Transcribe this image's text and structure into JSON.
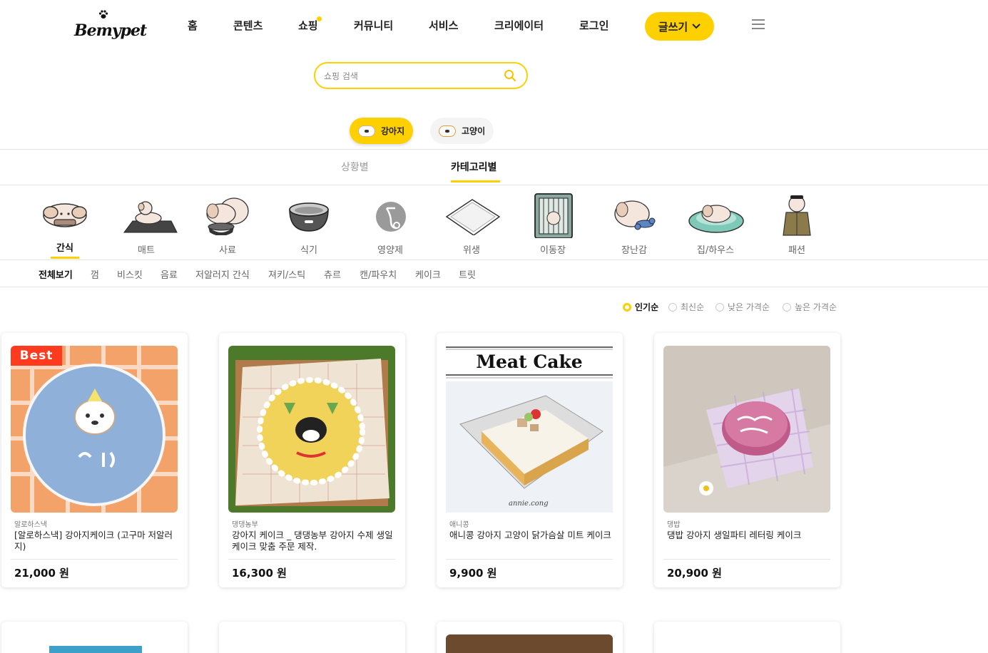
{
  "header": {
    "logo": "Bemypet",
    "nav": [
      {
        "label": "홈"
      },
      {
        "label": "콘텐츠"
      },
      {
        "label": "쇼핑"
      },
      {
        "label": "커뮤니티"
      },
      {
        "label": "서비스"
      },
      {
        "label": "크리에이터"
      },
      {
        "label": "로그인"
      }
    ],
    "write_button": "글쓰기",
    "accent": "#ffd000"
  },
  "search": {
    "placeholder": "쇼핑 검색",
    "value": ""
  },
  "pet_types": [
    {
      "label": "강아지",
      "active": true
    },
    {
      "label": "고양이",
      "active": false
    }
  ],
  "mode_tabs": [
    {
      "label": "상황별",
      "active": false
    },
    {
      "label": "카테고리별",
      "active": true
    }
  ],
  "categories": [
    {
      "label": "간식",
      "icon": "snack-dog-icon",
      "active": true
    },
    {
      "label": "매트",
      "icon": "mat-icon"
    },
    {
      "label": "사료",
      "icon": "food-bowl-dog-icon"
    },
    {
      "label": "식기",
      "icon": "bowl-icon"
    },
    {
      "label": "영양제",
      "icon": "supplement-icon"
    },
    {
      "label": "위생",
      "icon": "pee-pad-icon"
    },
    {
      "label": "이동장",
      "icon": "carrier-icon"
    },
    {
      "label": "장난감",
      "icon": "toy-icon"
    },
    {
      "label": "집/하우스",
      "icon": "house-cushion-icon"
    },
    {
      "label": "패션",
      "icon": "fashion-icon"
    }
  ],
  "subcategories": [
    {
      "label": "전체보기",
      "active": true
    },
    {
      "label": "껌"
    },
    {
      "label": "비스킷"
    },
    {
      "label": "음료"
    },
    {
      "label": "저알러지 간식"
    },
    {
      "label": "져키/스틱"
    },
    {
      "label": "츄르"
    },
    {
      "label": "캔/파우치"
    },
    {
      "label": "케이크"
    },
    {
      "label": "트릿"
    }
  ],
  "sort_options": [
    {
      "label": "인기순",
      "active": true
    },
    {
      "label": "최신순"
    },
    {
      "label": "낮은 가격순"
    },
    {
      "label": "높은 가격순"
    }
  ],
  "products": [
    {
      "seller": "알로하스낵",
      "title": "[알로하스낵] 강아지케이크 (고구마 저알러지)",
      "price": "21,000 원",
      "badge": "Best"
    },
    {
      "seller": "댕댕농부",
      "title": "강아지 케이크 _ 댕댕농부 강아지 수제 생일 케이크 맞춤 주문 제작.",
      "price": "16,300 원"
    },
    {
      "seller": "애니콩",
      "title": "애니콩 강아지 고양이 닭가슴살 미트 케이크",
      "price": "9,900 원",
      "image_caption": "Meat Cake",
      "image_signature": "annie.cong"
    },
    {
      "seller": "댕밥",
      "title": "댕밥 강아지 생일파티 레터링 케이크",
      "price": "20,900 원"
    }
  ]
}
